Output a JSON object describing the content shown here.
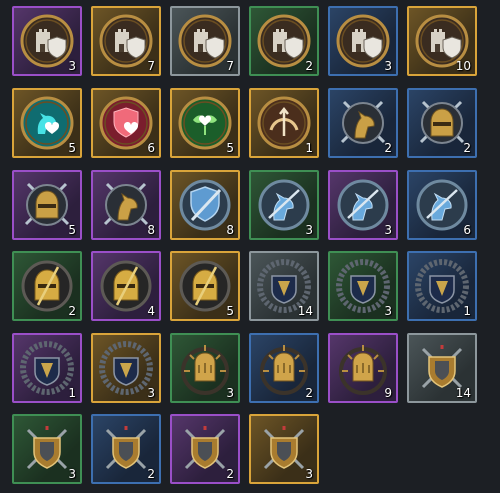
{
  "items": [
    {
      "icon": "tower-shield-icon",
      "rarity": "purple",
      "count": "3"
    },
    {
      "icon": "tower-shield-icon",
      "rarity": "gold",
      "count": "7"
    },
    {
      "icon": "tower-shield-icon",
      "rarity": "gray",
      "count": "7"
    },
    {
      "icon": "tower-shield-icon",
      "rarity": "green",
      "count": "2"
    },
    {
      "icon": "tower-shield-icon",
      "rarity": "blue",
      "count": "3"
    },
    {
      "icon": "tower-shield-icon",
      "rarity": "gold",
      "count": "10"
    },
    {
      "icon": "horse-heart-icon",
      "rarity": "gold",
      "count": "5"
    },
    {
      "icon": "shield-heart-icon",
      "rarity": "gold",
      "count": "6"
    },
    {
      "icon": "leaf-heart-icon",
      "rarity": "gold",
      "count": "5"
    },
    {
      "icon": "bow-arrow-icon",
      "rarity": "gold",
      "count": "1"
    },
    {
      "icon": "cavalry-swords-icon",
      "rarity": "blue",
      "count": "2"
    },
    {
      "icon": "helmet-sword-icon",
      "rarity": "blue",
      "count": "2"
    },
    {
      "icon": "helmet-sword-icon",
      "rarity": "purple",
      "count": "5"
    },
    {
      "icon": "cavalry-swords-icon",
      "rarity": "purple",
      "count": "8"
    },
    {
      "icon": "blue-shield-sword-icon",
      "rarity": "gold",
      "count": "8"
    },
    {
      "icon": "blue-horse-sword-icon",
      "rarity": "green",
      "count": "3"
    },
    {
      "icon": "blue-horse-sword-icon",
      "rarity": "purple",
      "count": "3"
    },
    {
      "icon": "blue-horse-sword-icon",
      "rarity": "blue",
      "count": "6"
    },
    {
      "icon": "gold-helmet-spear-icon",
      "rarity": "green",
      "count": "2"
    },
    {
      "icon": "gold-helmet-spear-icon",
      "rarity": "purple",
      "count": "4"
    },
    {
      "icon": "gold-helmet-spear-icon",
      "rarity": "gold",
      "count": "5"
    },
    {
      "icon": "wreath-shield-icon",
      "rarity": "gray",
      "count": "14"
    },
    {
      "icon": "wreath-shield-icon",
      "rarity": "green",
      "count": "3"
    },
    {
      "icon": "wreath-shield-icon",
      "rarity": "blue",
      "count": "1"
    },
    {
      "icon": "wreath-shield-icon",
      "rarity": "purple",
      "count": "1"
    },
    {
      "icon": "wreath-shield-icon",
      "rarity": "gold",
      "count": "3"
    },
    {
      "icon": "gauntlet-wheel-icon",
      "rarity": "green",
      "count": "3"
    },
    {
      "icon": "gauntlet-wheel-icon",
      "rarity": "blue",
      "count": "2"
    },
    {
      "icon": "gauntlet-wheel-icon",
      "rarity": "purple",
      "count": "9"
    },
    {
      "icon": "knight-crest-icon",
      "rarity": "gray",
      "count": "14"
    },
    {
      "icon": "knight-crest-icon",
      "rarity": "green",
      "count": "3"
    },
    {
      "icon": "knight-crest-icon",
      "rarity": "blue",
      "count": "2"
    },
    {
      "icon": "knight-crest-icon",
      "rarity": "purple",
      "count": "2"
    },
    {
      "icon": "knight-crest-icon",
      "rarity": "gold",
      "count": "3"
    }
  ]
}
